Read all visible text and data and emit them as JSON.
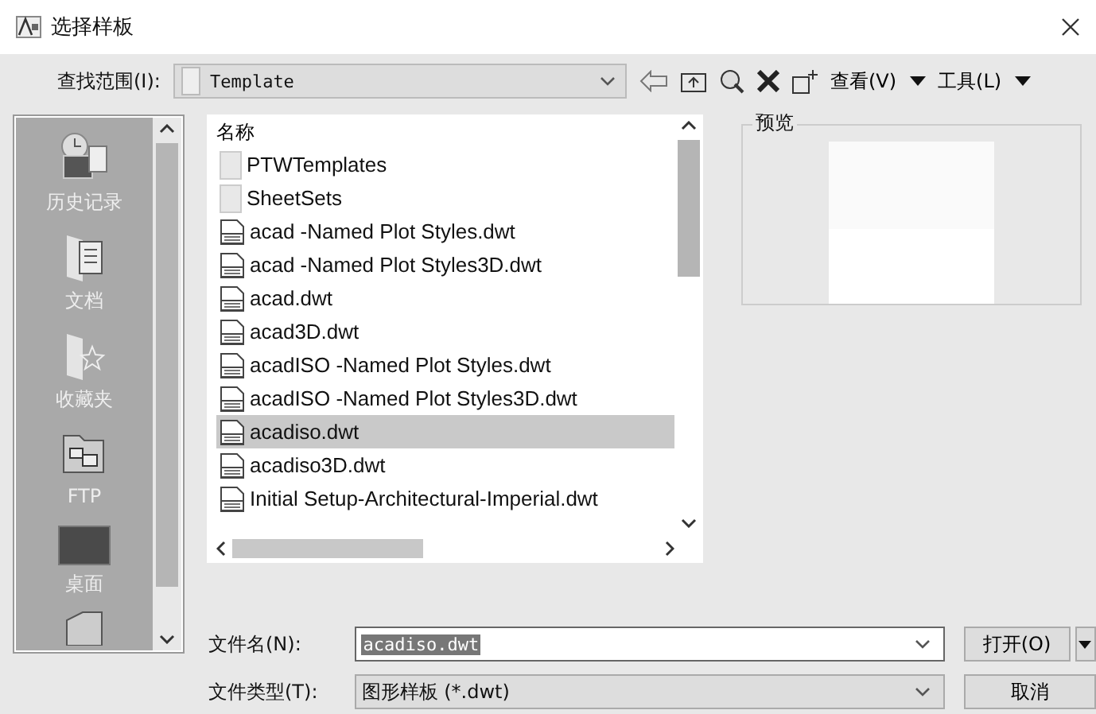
{
  "window": {
    "title": "选择样板"
  },
  "toolbar": {
    "look_in_label": "查找范围(I):",
    "look_in_value": "Template",
    "views_menu": "查看(V)",
    "tools_menu": "工具(L)"
  },
  "places": [
    {
      "label": "历史记录",
      "kind": "history"
    },
    {
      "label": "文档",
      "kind": "documents"
    },
    {
      "label": "收藏夹",
      "kind": "favorites"
    },
    {
      "label": "FTP",
      "kind": "ftp"
    },
    {
      "label": "桌面",
      "kind": "desktop"
    },
    {
      "kind": "folder"
    }
  ],
  "file_list": {
    "column": "名称",
    "items": [
      {
        "name": "PTWTemplates",
        "kind": "folder",
        "selected": false
      },
      {
        "name": "SheetSets",
        "kind": "folder",
        "selected": false
      },
      {
        "name": "acad -Named Plot Styles.dwt",
        "kind": "dwt",
        "selected": false
      },
      {
        "name": "acad -Named Plot Styles3D.dwt",
        "kind": "dwt",
        "selected": false
      },
      {
        "name": "acad.dwt",
        "kind": "dwt",
        "selected": false
      },
      {
        "name": "acad3D.dwt",
        "kind": "dwt",
        "selected": false
      },
      {
        "name": "acadISO -Named Plot Styles.dwt",
        "kind": "dwt",
        "selected": false
      },
      {
        "name": "acadISO -Named Plot Styles3D.dwt",
        "kind": "dwt",
        "selected": false
      },
      {
        "name": "acadiso.dwt",
        "kind": "dwt",
        "selected": true
      },
      {
        "name": "acadiso3D.dwt",
        "kind": "dwt",
        "selected": false
      },
      {
        "name": "Initial Setup-Architectural-Imperial.dwt",
        "kind": "dwt",
        "selected": false
      }
    ]
  },
  "preview": {
    "label": "预览"
  },
  "file_name": {
    "label": "文件名(N):",
    "value": "acadiso.dwt"
  },
  "file_type": {
    "label": "文件类型(T):",
    "value": "图形样板 (*.dwt)"
  },
  "buttons": {
    "open": "打开(O)",
    "cancel": "取消"
  }
}
